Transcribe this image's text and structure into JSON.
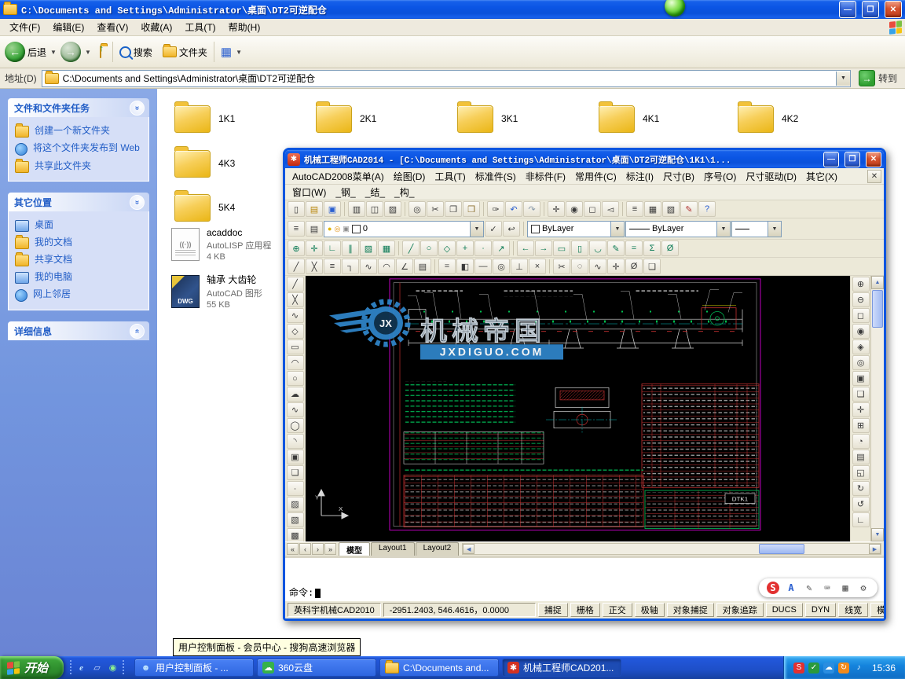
{
  "explorer": {
    "title": "C:\\Documents and Settings\\Administrator\\桌面\\DT2可逆配仓",
    "menu_items": [
      "文件(F)",
      "编辑(E)",
      "查看(V)",
      "收藏(A)",
      "工具(T)",
      "帮助(H)"
    ],
    "toolbar": {
      "back_label": "后退",
      "search_label": "搜索",
      "folders_label": "文件夹"
    },
    "address_label": "地址(D)",
    "address_value": "C:\\Documents and Settings\\Administrator\\桌面\\DT2可逆配仓",
    "go_label": "转到",
    "sidebar_sections": [
      {
        "title": "文件和文件夹任务",
        "collapsed": false,
        "items": [
          {
            "label": "创建一个新文件夹",
            "icon": "new-folder-icon",
            "type": "folder"
          },
          {
            "label": "将这个文件夹发布到 Web",
            "icon": "publish-web-icon",
            "type": "globe"
          },
          {
            "label": "共享此文件夹",
            "icon": "share-folder-icon",
            "type": "folder"
          }
        ]
      },
      {
        "title": "其它位置",
        "collapsed": false,
        "items": [
          {
            "label": "桌面",
            "icon": "desktop-icon",
            "type": "screen"
          },
          {
            "label": "我的文档",
            "icon": "my-documents-icon",
            "type": "folder"
          },
          {
            "label": "共享文档",
            "icon": "shared-documents-icon",
            "type": "folder"
          },
          {
            "label": "我的电脑",
            "icon": "my-computer-icon",
            "type": "screen"
          },
          {
            "label": "网上邻居",
            "icon": "network-places-icon",
            "type": "globe"
          }
        ]
      },
      {
        "title": "详细信息",
        "collapsed": true,
        "items": []
      }
    ],
    "folders": [
      "1K1",
      "2K1",
      "3K1",
      "4K1",
      "4K2",
      "4K3",
      "5K4"
    ],
    "files": [
      {
        "name": "acaddoc",
        "type": "AutoLISP 应用程",
        "size": "4 KB",
        "kind": "lisp"
      },
      {
        "name": "轴承 大齿轮",
        "type": "AutoCAD 图形",
        "size": "55 KB",
        "kind": "dwg"
      }
    ]
  },
  "cad": {
    "title": "机械工程师CAD2014 - [C:\\Documents and Settings\\Administrator\\桌面\\DT2可逆配仓\\1K1\\1...",
    "menu_row1": [
      "AutoCAD2008菜单(A)",
      "绘图(D)",
      "工具(T)",
      "标准件(S)",
      "非标件(F)",
      "常用件(C)",
      "标注(I)",
      "尺寸(B)",
      "序号(O)",
      "尺寸驱动(D)",
      "其它(X)"
    ],
    "menu_row2": [
      "窗口(W)",
      "_钢_",
      "_结_",
      "_构_"
    ],
    "layer_value": "0",
    "color_value": "ByLayer",
    "linetype_value": "ByLayer",
    "tabs": [
      "模型",
      "Layout1",
      "Layout2"
    ],
    "active_tab": "模型",
    "command_prompt": "命令:",
    "status_left": "英科宇机械CAD2010",
    "coords": "-2951.2403, 546.4616，0.0000",
    "status_buttons": [
      "捕捉",
      "栅格",
      "正交",
      "极轴",
      "对象捕捉",
      "对象追踪",
      "DUCS",
      "DYN",
      "线宽",
      "模型"
    ],
    "watermark_title": "机械帝国",
    "watermark_domain": "JXDIGUO.COM",
    "watermark_badge": "JX",
    "titleblock_code": "DTK1",
    "toolbars": {
      "standard": [
        "new",
        "open",
        "save",
        "print",
        "preview",
        "plot",
        "find",
        "cut",
        "copy",
        "paste",
        "match-properties",
        "undo",
        "redo",
        "pan",
        "zoom-realtime",
        "zoom-window",
        "zoom-previous",
        "properties",
        "designcenter",
        "toolpalettes",
        "markup",
        "help"
      ],
      "layers_left": [
        "layer-manager",
        "layer-states"
      ],
      "layers_right": [
        "make-current",
        "layer-previous"
      ],
      "draw_row": [
        "snap-point",
        "polar-snap",
        "ortho-lines",
        "parallel",
        "hatch-pick",
        "table-cell",
        "line-teal",
        "circle-teal",
        "polygon-teal",
        "plus-teal",
        "node",
        "leader",
        "arrow-left",
        "arrow-right",
        "rect-hollow",
        "column",
        "fillet-small",
        "edit-poly",
        "equalize",
        "sigma",
        "zero-set"
      ],
      "modify_row": [
        "line",
        "construction-line",
        "multiline",
        "polyline-edit",
        "spline-edit",
        "arc-edit",
        "angle",
        "hatch-lines",
        "equal",
        "mirror-x",
        "dash",
        "donut",
        "pin",
        "cross",
        "scissors",
        "circle-group",
        "spline-group",
        "ucs",
        "measure",
        "group"
      ],
      "left_tools": [
        "line",
        "construction-line",
        "polyline",
        "polygon",
        "rectangle",
        "arc",
        "circle",
        "revision-cloud",
        "spline",
        "ellipse",
        "ellipse-arc",
        "insert-block",
        "make-block",
        "point",
        "hatch",
        "gradient",
        "region",
        "table",
        "multiline-text"
      ],
      "right_tools": [
        "zoom-in",
        "zoom-out",
        "zoom-window",
        "zoom-dynamic",
        "zoom-scale",
        "zoom-center",
        "zoom-object",
        "zoom-all",
        "zoom-extents",
        "pan-realtime",
        "orbit",
        "named-views",
        "front-view",
        "redraw",
        "regen",
        "ucs-icon"
      ]
    }
  },
  "sogou_bar": [
    "sogou-logo",
    "mode-letter",
    "handwrite-pen",
    "soft-keyboard",
    "symbol-grid",
    "toolbox"
  ],
  "tooltip_text": "用户控制面板 - 会员中心 - 搜狗高速浏览器",
  "taskbar": {
    "start_label": "开始",
    "quick_launch": [
      "ie-icon",
      "show-desktop-icon",
      "browser-360-icon"
    ],
    "tasks": [
      {
        "label": "用户控制面板 - ...",
        "icon": "user-panel-icon",
        "active": false
      },
      {
        "label": "360云盘",
        "icon": "cloud-360-icon",
        "active": false
      },
      {
        "label": "C:\\Documents and...",
        "icon": "folder-icon",
        "active": false
      },
      {
        "label": "机械工程师CAD201...",
        "icon": "cad-app-icon",
        "active": true
      }
    ],
    "tray_icons": [
      "sogou-tray-icon",
      "shield-tray-icon",
      "cloud-tray-icon",
      "update-tray-icon",
      "volume-tray-icon"
    ],
    "clock": "15:36"
  }
}
